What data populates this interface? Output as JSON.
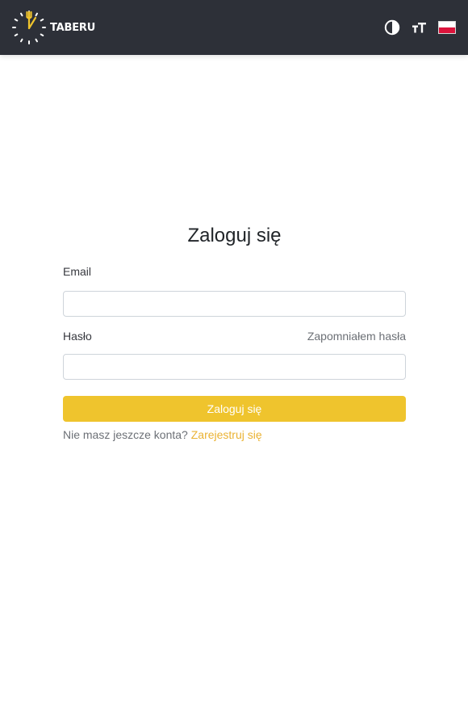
{
  "header": {
    "brand": "TABERU",
    "icons": {
      "theme": "contrast-icon",
      "font_size": "text-size-icon",
      "language": "poland-flag-icon"
    },
    "colors": {
      "background": "#2d3038",
      "accent": "#efc42d"
    }
  },
  "login": {
    "title": "Zaloguj się",
    "email_label": "Email",
    "email_value": "",
    "password_label": "Hasło",
    "password_value": "",
    "forgot_password": "Zapomniałem hasła",
    "submit": "Zaloguj się",
    "no_account": "Nie masz jeszcze konta?",
    "register": "Zarejestruj się"
  }
}
